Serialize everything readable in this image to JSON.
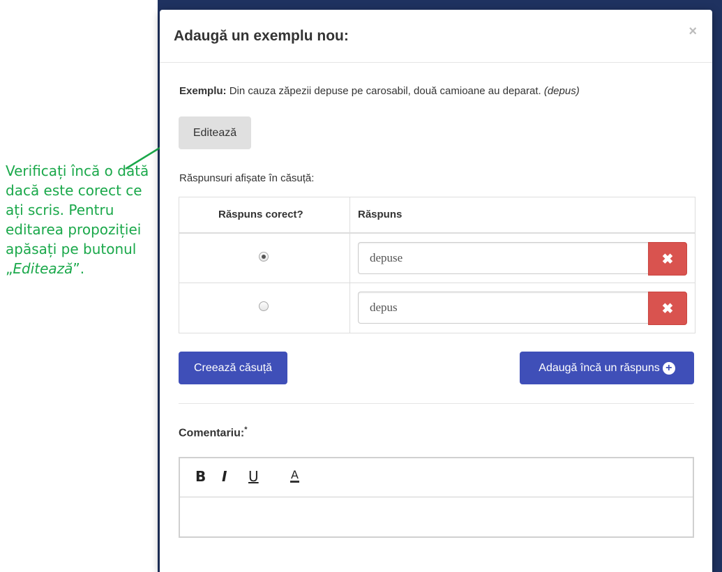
{
  "annotation": {
    "text": "Verificați încă o dată dacă este corect ce ați scris. Pentru editarea propoziției apăsați pe butonul „",
    "emph": "Editează",
    "tail": "”."
  },
  "modal": {
    "title": "Adaugă un exemplu nou:",
    "close": "×",
    "example_label": "Exemplu:",
    "example_text": "Din cauza zăpezii depuse pe carosabil, două camioane au deparat.",
    "example_hint": "(depus)",
    "edit_label": "Editează",
    "answers_label": "Răspunsuri afișate în căsuță:",
    "table": {
      "headers": [
        "Răspuns corect?",
        "Răspuns"
      ],
      "rows": [
        {
          "correct": true,
          "answer": "depuse"
        },
        {
          "correct": false,
          "answer": "depus"
        }
      ]
    },
    "create_label": "Creează căsuță",
    "add_label": "Adaugă încă un răspuns",
    "comment_label": "Comentariu:",
    "required_mark": "*",
    "toolbar": {
      "bold": "B",
      "italic": "I",
      "underline": "U",
      "color": "A"
    }
  },
  "colors": {
    "primary": "#3f4fb8",
    "danger": "#d9534f",
    "annotation": "#1aa84a"
  },
  "icons": [
    "close-icon",
    "delete-icon",
    "plus-circle-icon",
    "arrow-icon"
  ]
}
